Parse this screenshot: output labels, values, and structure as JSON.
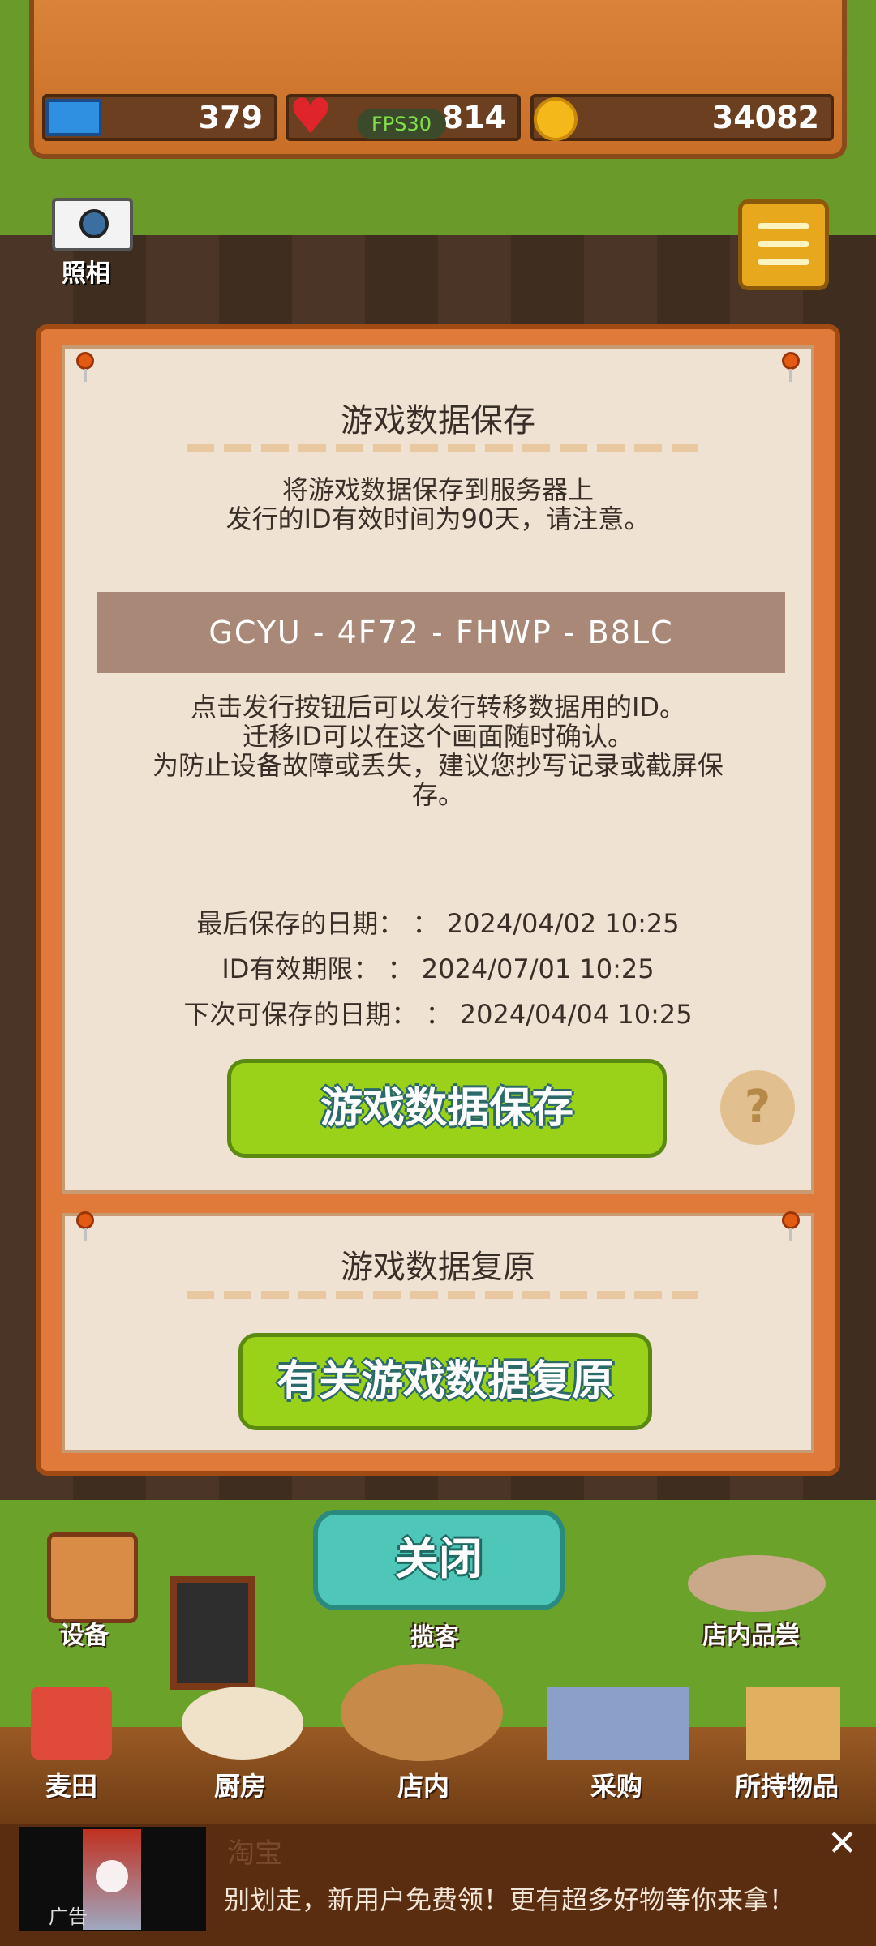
{
  "hud": {
    "tickets": "379",
    "hearts": "814",
    "fps": "FPS30",
    "coins": "34082"
  },
  "camera_label": "照相",
  "dialog": {
    "save_title": "游戏数据保存",
    "save_desc_1": "将游戏数据保存到服务器上",
    "save_desc_2": "发行的ID有效时间为90天，请注意。",
    "transfer_id": "GCYU - 4F72 - FHWP - B8LC",
    "note_1": "点击发行按钮后可以发行转移数据用的ID。",
    "note_2": "迁移ID可以在这个画面随时确认。",
    "note_3": "为防止设备故障或丢失，建议您抄写记录或截屏保",
    "note_4": "存。",
    "last_saved": "最后保存的日期： ： 2024/04/02 10:25",
    "id_expiry": "ID有效期限： ： 2024/07/01 10:25",
    "next_save": "下次可保存的日期： ： 2024/04/04 10:25",
    "save_button": "游戏数据保存",
    "help_button": "?",
    "restore_title": "游戏数据复原",
    "restore_button": "有关游戏数据复原"
  },
  "close_button": "关闭",
  "side": {
    "equipment": "设备",
    "attract": "揽客",
    "tasting": "店内品尝"
  },
  "nav": [
    "麦田",
    "厨房",
    "店内",
    "采购",
    "所持物品"
  ],
  "ad": {
    "tag": "广告",
    "brand": "淘宝",
    "text": "别划走，新用户免费领！更有超多好物等你来拿！",
    "close": "✕"
  }
}
